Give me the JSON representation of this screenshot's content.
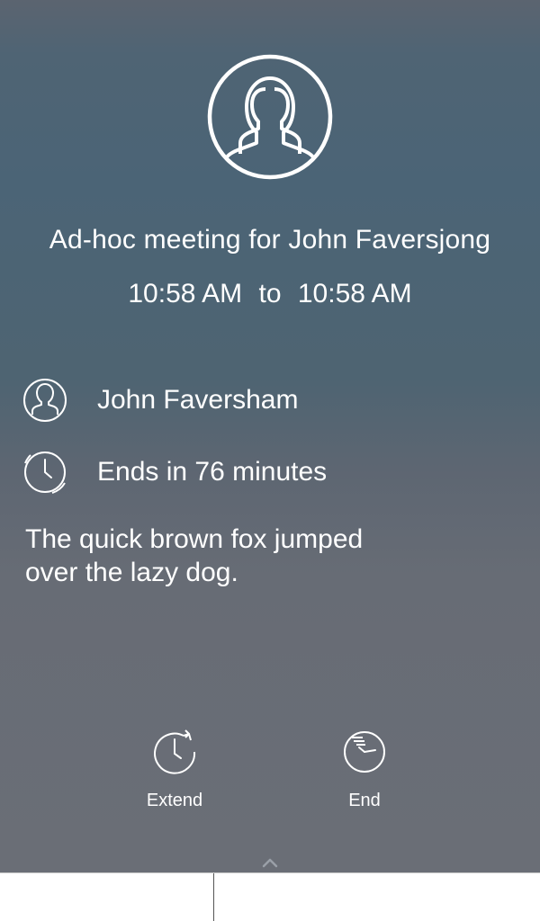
{
  "meeting": {
    "title": "Ad-hoc meeting for John Faversjong",
    "start_time": "10:58 AM",
    "time_separator": "to",
    "end_time": "10:58 AM",
    "organizer": "John Faversham",
    "ends_in": "Ends in 76 minutes",
    "notes": "The quick brown fox jumped over the lazy dog."
  },
  "actions": {
    "extend_label": "Extend",
    "end_label": "End"
  },
  "icons": {
    "group": "group-avatar-icon",
    "person": "person-icon",
    "clock": "clock-icon",
    "extend": "extend-clock-icon",
    "end": "end-clock-icon",
    "expand": "chevron-up-icon"
  },
  "colors": {
    "foreground": "#ffffff",
    "background_top": "#4b6476",
    "background_bottom": "#6a6e76",
    "bottom_panel": "#ffffff"
  }
}
